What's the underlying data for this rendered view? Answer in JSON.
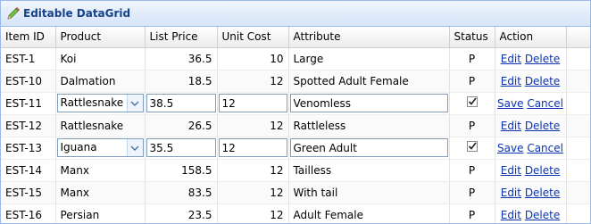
{
  "panel": {
    "title": "Editable DataGrid"
  },
  "columns": {
    "item_id": "Item ID",
    "product": "Product",
    "list_price": "List Price",
    "unit_cost": "Unit Cost",
    "attribute": "Attribute",
    "status": "Status",
    "action": "Action"
  },
  "actions": {
    "edit": "Edit",
    "delete": "Delete",
    "save": "Save",
    "cancel": "Cancel"
  },
  "rows": [
    {
      "item_id": "EST-1",
      "product": "Koi",
      "list_price": "36.5",
      "unit_cost": "10",
      "attribute": "Large",
      "status": "P",
      "editing": false
    },
    {
      "item_id": "EST-10",
      "product": "Dalmation",
      "list_price": "18.5",
      "unit_cost": "12",
      "attribute": "Spotted Adult Female",
      "status": "P",
      "editing": false
    },
    {
      "item_id": "EST-11",
      "product": "Rattlesnake",
      "list_price": "38.5",
      "unit_cost": "12",
      "attribute": "Venomless",
      "status": "checked",
      "editing": true
    },
    {
      "item_id": "EST-12",
      "product": "Rattlesnake",
      "list_price": "26.5",
      "unit_cost": "12",
      "attribute": "Rattleless",
      "status": "P",
      "editing": false
    },
    {
      "item_id": "EST-13",
      "product": "Iguana",
      "list_price": "35.5",
      "unit_cost": "12",
      "attribute": "Green Adult",
      "status": "checked",
      "editing": true
    },
    {
      "item_id": "EST-14",
      "product": "Manx",
      "list_price": "158.5",
      "unit_cost": "12",
      "attribute": "Tailless",
      "status": "P",
      "editing": false
    },
    {
      "item_id": "EST-15",
      "product": "Manx",
      "list_price": "83.5",
      "unit_cost": "12",
      "attribute": "With tail",
      "status": "P",
      "editing": false
    },
    {
      "item_id": "EST-16",
      "product": "Persian",
      "list_price": "23.5",
      "unit_cost": "12",
      "attribute": "Adult Female",
      "status": "P",
      "editing": false
    }
  ],
  "colors": {
    "header_text": "#15428b",
    "link": "#0b33b3",
    "border": "#99bbe8"
  }
}
